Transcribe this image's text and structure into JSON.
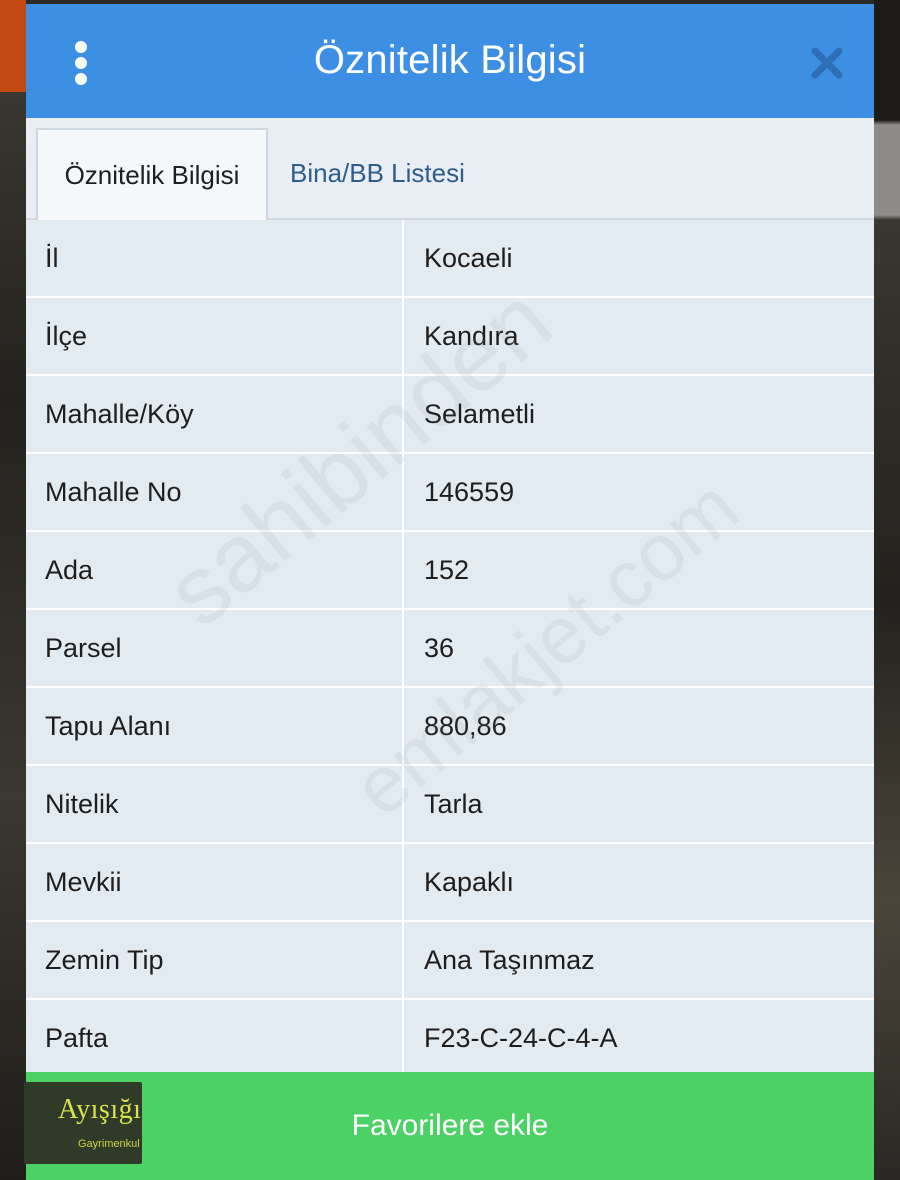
{
  "header": {
    "title": "Öznitelik Bilgisi"
  },
  "tabs": [
    {
      "label": "Öznitelik Bilgisi",
      "active": true
    },
    {
      "label": "Bina/BB Listesi",
      "active": false
    }
  ],
  "rows": [
    {
      "key": "İl",
      "value": "Kocaeli"
    },
    {
      "key": "İlçe",
      "value": "Kandıra"
    },
    {
      "key": "Mahalle/Köy",
      "value": "Selametli"
    },
    {
      "key": "Mahalle No",
      "value": "146559"
    },
    {
      "key": "Ada",
      "value": "152"
    },
    {
      "key": "Parsel",
      "value": "36"
    },
    {
      "key": "Tapu Alanı",
      "value": "880,86"
    },
    {
      "key": "Nitelik",
      "value": "Tarla"
    },
    {
      "key": "Mevkii",
      "value": "Kapaklı"
    },
    {
      "key": "Zemin Tip",
      "value": "Ana Taşınmaz"
    },
    {
      "key": "Pafta",
      "value": "F23-C-24-C-4-A"
    }
  ],
  "favorite_button": {
    "label": "Favorilere ekle"
  },
  "watermark": {
    "line1": "sahibinden",
    "line2": "emlakjet.com"
  },
  "logo": {
    "name": "Ayışığı",
    "subtitle": "Gayrimenkul"
  },
  "colors": {
    "header": "#3d8fe4",
    "button": "#4cd264",
    "table_bg": "#e2eaf2"
  }
}
